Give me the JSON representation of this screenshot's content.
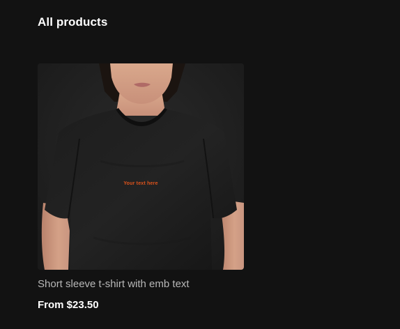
{
  "section": {
    "title": "All products"
  },
  "products": [
    {
      "name": "Short sleeve t-shirt with emb text",
      "price": "From $23.50",
      "print_text": "Your text here",
      "print_color": "#e0541c"
    }
  ]
}
